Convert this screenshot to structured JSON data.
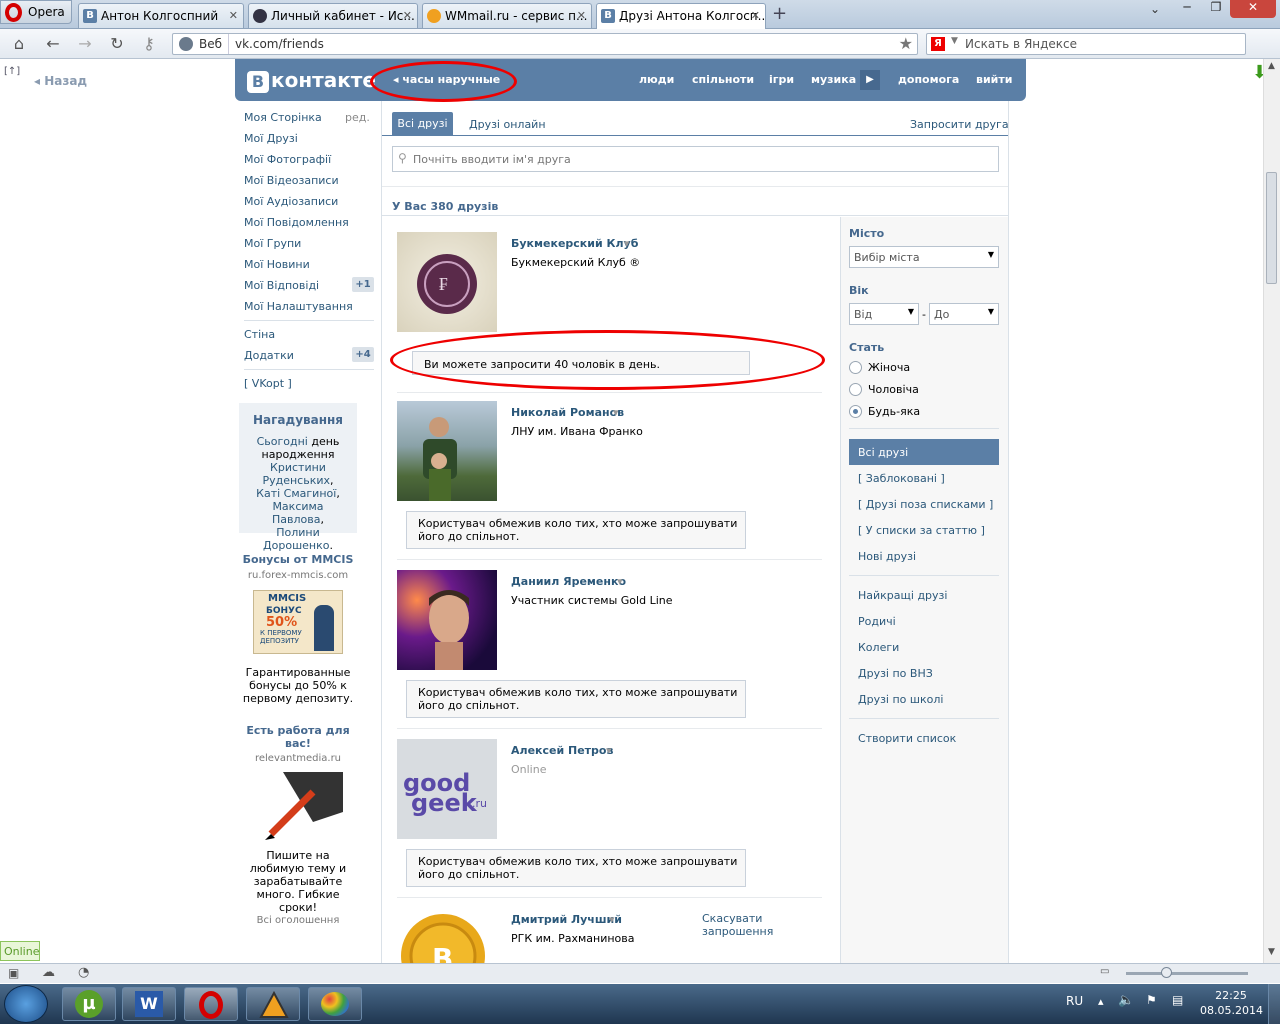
{
  "browser": {
    "opera_label": "Opera",
    "tabs": [
      {
        "label": "Антон Колгоспний",
        "favicon": "vk-icon"
      },
      {
        "label": "Личный кабинет - Ис...",
        "favicon": "card-icon"
      },
      {
        "label": "WMmail.ru - сервис п...",
        "favicon": "wmmail-icon"
      },
      {
        "label": "Друзі Антона Колгосп...",
        "favicon": "vk-icon"
      }
    ],
    "new_tab": "+",
    "web_label": "Веб",
    "url": "vk.com/friends",
    "search_placeholder": "Искать в Яндексе",
    "yandex_letter": "Я",
    "back_label": "Назад",
    "back_icon": "[↑]"
  },
  "vk": {
    "logo_letter": "В",
    "logo_text": "контакте",
    "breadcrumb": "часы наручные",
    "nav": [
      "люди",
      "спільноти",
      "ігри",
      "музика",
      "допомога",
      "вийти"
    ],
    "left_menu": [
      {
        "label": "Моя Сторінка",
        "extra": "ред."
      },
      {
        "label": "Мої Друзі"
      },
      {
        "label": "Мої Фотографії"
      },
      {
        "label": "Мої Відеозаписи"
      },
      {
        "label": "Мої Аудіозаписи"
      },
      {
        "label": "Мої Повідомлення"
      },
      {
        "label": "Мої Групи"
      },
      {
        "label": "Мої Новини"
      },
      {
        "label": "Мої Відповіді",
        "badge": "+1"
      },
      {
        "label": "Мої Налаштування"
      },
      {
        "label": "Стіна"
      },
      {
        "label": "Додатки",
        "badge": "+4"
      },
      {
        "label": "[ VKopt ]"
      }
    ],
    "reminder": {
      "title": "Нагадування",
      "today": "Сьогодні",
      "text1": "день народження",
      "names": [
        "Кристини Руденських",
        "Каті Смагиної",
        "Максима Павлова",
        "Полини Дорошенко"
      ]
    },
    "ads": [
      {
        "title": "Бонусы от MMCIS",
        "host": "ru.forex-mmcis.com",
        "img_brand": "MMCIS",
        "img_line1": "БОНУС",
        "img_line2": "50%",
        "img_line3": "К ПЕРВОМУ ДЕПОЗИТУ",
        "text": "Гарантированные бонусы до 50% к первому депозиту."
      },
      {
        "title": "Есть работа для вас!",
        "host": "relevantmedia.ru",
        "text": "Пишите на любимую тему и зарабатывайте много. Гибкие сроки!"
      }
    ],
    "all_ads": "Всі оголошення",
    "tabs": {
      "all": "Всі друзі",
      "online": "Друзі онлайн",
      "invite": "Запросити друга"
    },
    "search_placeholder": "Почніть вводити ім'я друга",
    "count": "У Вас 380 друзів",
    "filters": {
      "city_label": "Місто",
      "city_value": "Вибір міста",
      "age_label": "Вік",
      "age_from": "Від",
      "age_dash": "-",
      "age_to": "До",
      "sex_label": "Стать",
      "sex_options": [
        "Жіноча",
        "Чоловіча",
        "Будь-яка"
      ],
      "sex_selected": 2
    },
    "lists": [
      "Всі друзі",
      "[ Заблоковані ]",
      "[ Друзі поза списками ]",
      "[ У списки за статтю ]",
      "Нові друзі",
      "Найкращі друзі",
      "Родичі",
      "Колеги",
      "Друзі по ВНЗ",
      "Друзі по школі",
      "Створити список"
    ],
    "friends": [
      {
        "name": "Букмекерский Клуб",
        "sub": "Букмекерский Клуб ®",
        "note": "Ви можете запросити 40 чоловік в день.",
        "photo": "bookmaker-logo"
      },
      {
        "name": "Николай Романов",
        "sub": "ЛНУ им. Ивана Франко",
        "note": "Користувач обмежив коло тих, хто може запрошувати його до спільнот.",
        "photo": "man-with-child"
      },
      {
        "name": "Даниил Яременко",
        "sub": "Участник системы Gold Line",
        "note": "Користувач обмежив коло тих, хто може запрошувати його до спільнот.",
        "photo": "man-portrait"
      },
      {
        "name": "Алексей Петров",
        "sub": "Online",
        "note": "Користувач обмежив коло тих, хто може запрошувати його до спільнот.",
        "photo": "goodgeek-logo",
        "logo_text1": "good",
        "logo_text2": "geek",
        "logo_text3": ".ru"
      },
      {
        "name": "Дмитрий Лучший",
        "sub": "РГК им. Рахманинова",
        "cancel": "Скасувати запрошення",
        "photo": "bitcoin-logo"
      }
    ],
    "dropdown_mark": "▾"
  },
  "statusbar": {
    "online": "Online"
  },
  "taskbar": {
    "lang": "RU",
    "time": "22:25",
    "date": "08.05.2014"
  },
  "colors": {
    "vk_blue": "#5b7fa6",
    "link": "#2b587a",
    "annotation_red": "#e00000"
  }
}
